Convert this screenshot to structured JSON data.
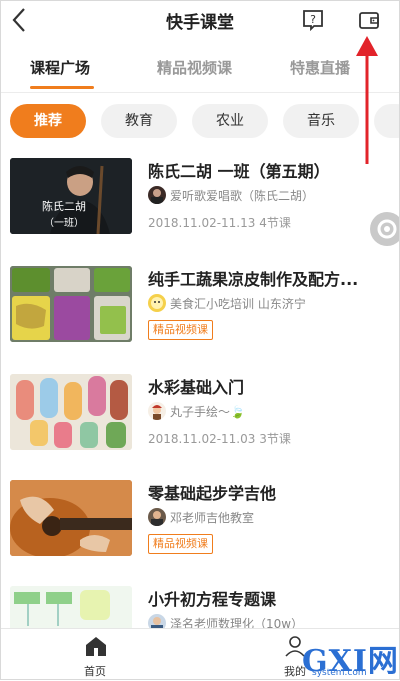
{
  "header": {
    "title": "快手课堂"
  },
  "tabs": [
    {
      "label": "课程广场"
    },
    {
      "label": "精品视频课"
    },
    {
      "label": "特惠直播"
    }
  ],
  "chips": [
    {
      "label": "推荐"
    },
    {
      "label": "教育"
    },
    {
      "label": "农业"
    },
    {
      "label": "音乐"
    },
    {
      "label": ""
    }
  ],
  "courses": [
    {
      "title": "陈氏二胡 一班（第五期）",
      "teacher": "爱听歌爱唱歌（陈氏二胡）",
      "meta": "2018.11.02-11.13 4节课",
      "thumb_text_1": "陈氏二胡",
      "thumb_text_2": "（一班）"
    },
    {
      "title": "纯手工蔬果凉皮制作及配方...",
      "teacher": "美食汇小吃培训 山东济宁",
      "badge": "精品视频课"
    },
    {
      "title": "水彩基础入门",
      "teacher": "丸子手绘～🍃",
      "meta": "2018.11.02-11.03 3节课"
    },
    {
      "title": "零基础起步学吉他",
      "teacher": "邓老师吉他教室",
      "badge": "精品视频课"
    },
    {
      "title": "小升初方程专题课",
      "teacher": "泽名老师数理化（10w）"
    }
  ],
  "bottom_nav": {
    "home": "首页",
    "me": "我的"
  },
  "watermark": {
    "big": "GXI网",
    "small": "system.com"
  },
  "colors": {
    "accent": "#f07d1d",
    "arrow": "#e2232a",
    "watermark": "#2b6fd3"
  }
}
